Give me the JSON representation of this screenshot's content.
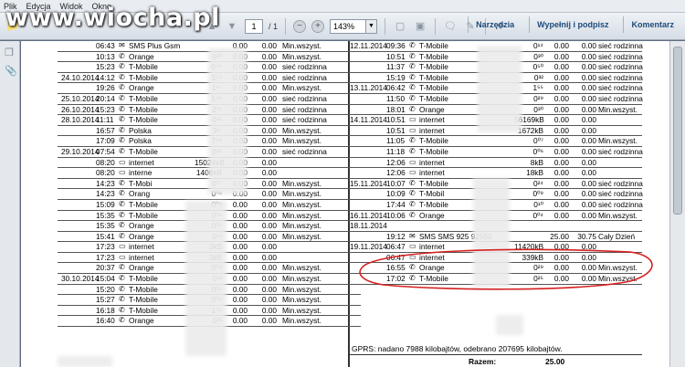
{
  "menu": {
    "items": [
      "Plik",
      "Edycja",
      "Widok",
      "Okno"
    ]
  },
  "watermark": "www.wiocha.pl",
  "toolbar": {
    "page_current": "1",
    "page_total": "/ 1",
    "zoom": "143%",
    "tools_label": "Narzędzia",
    "fill_sign_label": "Wypełnij i podpisz",
    "comments_label": "Komentarz"
  },
  "left_rows": [
    {
      "date": "",
      "time": "06:43",
      "icon": "sms-icon",
      "name": "SMS Plus Gsm",
      "dur": "",
      "price": "0.00",
      "cost": "0.00",
      "tariff": "Min.wszyst."
    },
    {
      "date": "",
      "time": "10:13",
      "icon": "phone-icon",
      "name": "Orange",
      "dur": "0²⁰",
      "price": "0.00",
      "cost": "0.00",
      "tariff": "Min.wszyst."
    },
    {
      "date": "",
      "time": "15:23",
      "icon": "phone-icon",
      "name": "T-Mobile",
      "dur": "0⁴⁶",
      "price": "0.00",
      "cost": "0.00",
      "tariff": "sieć rodzinna"
    },
    {
      "date": "24.10.2014",
      "time": "14:12",
      "icon": "phone-icon",
      "name": "T-Mobile",
      "dur": "1⁵⁸",
      "price": "0.00",
      "cost": "0.00",
      "tariff": "sieć rodzinna"
    },
    {
      "date": "",
      "time": "19:26",
      "icon": "phone-icon",
      "name": "Orange",
      "dur": "1⁹⁷",
      "price": "0.00",
      "cost": "0.00",
      "tariff": "Min.wszyst."
    },
    {
      "date": "25.10.2014",
      "time": "20:14",
      "icon": "phone-icon",
      "name": "T-Mobile",
      "dur": "1⁴⁹",
      "price": "0.00",
      "cost": "0.00",
      "tariff": "sieć rodzinna"
    },
    {
      "date": "26.10.2014",
      "time": "15:23",
      "icon": "phone-icon",
      "name": "T-Mobile",
      "dur": "2⁰¹",
      "price": "0.00",
      "cost": "0.00",
      "tariff": "sieć rodzinna"
    },
    {
      "date": "28.10.2014",
      "time": "11:11",
      "icon": "phone-icon",
      "name": "T-Mobile",
      "dur": "0³⁵",
      "price": "0.00",
      "cost": "0.00",
      "tariff": "sieć rodzinna"
    },
    {
      "date": "",
      "time": "16:57",
      "icon": "phone-icon",
      "name": "Polska",
      "dur": "3²⁷",
      "price": "0.00",
      "cost": "0.00",
      "tariff": "Min.wszyst."
    },
    {
      "date": "",
      "time": "17:09",
      "icon": "phone-icon",
      "name": "Polska",
      "dur": "7⁵⁸",
      "price": "0.00",
      "cost": "0.00",
      "tariff": "Min.wszyst."
    },
    {
      "date": "29.10.2014",
      "time": "07:54",
      "icon": "phone-icon",
      "name": "T-Mobile",
      "dur": "0²⁸",
      "price": "0.00",
      "cost": "0.00",
      "tariff": "sieć rodzinna"
    },
    {
      "date": "",
      "time": "08:20",
      "icon": "internet-icon",
      "name": "internet",
      "dur": "15024kB",
      "price": "0.00",
      "cost": "0.00",
      "tariff": ""
    },
    {
      "date": "",
      "time": "08:20",
      "icon": "internet-icon",
      "name": "interne",
      "dur": "1406kB",
      "price": "0.00",
      "cost": "0.00",
      "tariff": ""
    },
    {
      "date": "",
      "time": "14:23",
      "icon": "phone-icon",
      "name": "T-Mobi",
      "dur": "0⁰⁷",
      "price": "0.00",
      "cost": "0.00",
      "tariff": "Min.wszyst."
    },
    {
      "date": "",
      "time": "14:23",
      "icon": "phone-icon",
      "name": "Orang",
      "dur": "0⁰⁶",
      "price": "0.00",
      "cost": "0.00",
      "tariff": "Min.wszyst."
    },
    {
      "date": "",
      "time": "15:09",
      "icon": "phone-icon",
      "name": "T-Mobile",
      "dur": "0⁰⁹",
      "price": "0.00",
      "cost": "0.00",
      "tariff": "Min.wszyst."
    },
    {
      "date": "",
      "time": "15:35",
      "icon": "phone-icon",
      "name": "T-Mobile",
      "dur": "0⁰⁴",
      "price": "0.00",
      "cost": "0.00",
      "tariff": "Min.wszyst."
    },
    {
      "date": "",
      "time": "15:35",
      "icon": "phone-icon",
      "name": "Orange",
      "dur": "0⁰⁵",
      "price": "0.00",
      "cost": "0.00",
      "tariff": "Min.wszyst."
    },
    {
      "date": "",
      "time": "15:41",
      "icon": "phone-icon",
      "name": "Orange",
      "dur": "0¹⁹",
      "price": "0.00",
      "cost": "0.00",
      "tariff": "Min.wszyst."
    },
    {
      "date": "",
      "time": "17:23",
      "icon": "internet-icon",
      "name": "internet",
      "dur": "3kB",
      "price": "0.00",
      "cost": "0.00",
      "tariff": ""
    },
    {
      "date": "",
      "time": "17:23",
      "icon": "internet-icon",
      "name": "internet",
      "dur": "3kB",
      "price": "0.00",
      "cost": "0.00",
      "tariff": ""
    },
    {
      "date": "",
      "time": "20:37",
      "icon": "phone-icon",
      "name": "Orange",
      "dur": "0⁰⁹",
      "price": "0.00",
      "cost": "0.00",
      "tariff": "Min.wszyst."
    },
    {
      "date": "30.10.2014",
      "time": "15:04",
      "icon": "phone-icon",
      "name": "T-Mobile",
      "dur": "0¹²",
      "price": "0.00",
      "cost": "0.00",
      "tariff": "Min.wszyst."
    },
    {
      "date": "",
      "time": "15:20",
      "icon": "phone-icon",
      "name": "T-Mobile",
      "dur": "0⁰⁵",
      "price": "0.00",
      "cost": "0.00",
      "tariff": "Min.wszyst."
    },
    {
      "date": "",
      "time": "15:27",
      "icon": "phone-icon",
      "name": "T-Mobile",
      "dur": "0⁰⁸",
      "price": "0.00",
      "cost": "0.00",
      "tariff": "Min.wszyst."
    },
    {
      "date": "",
      "time": "16:18",
      "icon": "phone-icon",
      "name": "T-Mobile",
      "dur": "1⁰⁵",
      "price": "0.00",
      "cost": "0.00",
      "tariff": "Min.wszyst."
    },
    {
      "date": "",
      "time": "16:40",
      "icon": "phone-icon",
      "name": "Orange",
      "dur": "0²³",
      "price": "0.00",
      "cost": "0.00",
      "tariff": "Min.wszyst."
    }
  ],
  "right_rows": [
    {
      "date": "12.11.2014",
      "time": "09:36",
      "icon": "phone-icon",
      "name": "T-Mobile",
      "dur": "0¹⁴",
      "price": "0.00",
      "cost": "0.00",
      "tariff": "sieć rodzinna"
    },
    {
      "date": "",
      "time": "10:51",
      "icon": "phone-icon",
      "name": "T-Mobile",
      "dur": "0³⁰",
      "price": "0.00",
      "cost": "0.00",
      "tariff": "sieć rodzinna"
    },
    {
      "date": "",
      "time": "11:37",
      "icon": "phone-icon",
      "name": "T-Mobile",
      "dur": "0⁵⁰",
      "price": "0.00",
      "cost": "0.00",
      "tariff": "sieć rodzinna"
    },
    {
      "date": "",
      "time": "15:19",
      "icon": "phone-icon",
      "name": "T-Mobile",
      "dur": "0³²",
      "price": "0.00",
      "cost": "0.00",
      "tariff": "sieć rodzinna"
    },
    {
      "date": "13.11.2014",
      "time": "06:42",
      "icon": "phone-icon",
      "name": "T-Mobile",
      "dur": "1⁵⁵",
      "price": "0.00",
      "cost": "0.00",
      "tariff": "sieć rodzinna"
    },
    {
      "date": "",
      "time": "11:50",
      "icon": "phone-icon",
      "name": "T-Mobile",
      "dur": "0²⁹",
      "price": "0.00",
      "cost": "0.00",
      "tariff": "sieć rodzinna"
    },
    {
      "date": "",
      "time": "18:01",
      "icon": "phone-icon",
      "name": "Orange",
      "dur": "0³⁰",
      "price": "0.00",
      "cost": "0.00",
      "tariff": "Min.wszyst."
    },
    {
      "date": "14.11.2014",
      "time": "10:51",
      "icon": "internet-icon",
      "name": "internet",
      "dur": "56169kB",
      "price": "0.00",
      "cost": "0.00",
      "tariff": ""
    },
    {
      "date": "",
      "time": "10:51",
      "icon": "internet-icon",
      "name": "internet",
      "dur": "1672kB",
      "price": "0.00",
      "cost": "0.00",
      "tariff": ""
    },
    {
      "date": "",
      "time": "11:05",
      "icon": "phone-icon",
      "name": "T-Mobile",
      "dur": "0⁰⁷",
      "price": "0.00",
      "cost": "0.00",
      "tariff": "Min.wszyst."
    },
    {
      "date": "",
      "time": "11:18",
      "icon": "phone-icon",
      "name": "T-Mobile",
      "dur": "0⁰⁶",
      "price": "0.00",
      "cost": "0.00",
      "tariff": "sieć rodzinna"
    },
    {
      "date": "",
      "time": "12:06",
      "icon": "internet-icon",
      "name": "internet",
      "dur": "8kB",
      "price": "0.00",
      "cost": "0.00",
      "tariff": ""
    },
    {
      "date": "",
      "time": "12:06",
      "icon": "internet-icon",
      "name": "internet",
      "dur": "18kB",
      "price": "0.00",
      "cost": "0.00",
      "tariff": ""
    },
    {
      "date": "15.11.2014",
      "time": "10:07",
      "icon": "phone-icon",
      "name": "T-Mobile",
      "dur": "0²⁴",
      "price": "0.00",
      "cost": "0.00",
      "tariff": "sieć rodzinna"
    },
    {
      "date": "",
      "time": "10:09",
      "icon": "phone-icon",
      "name": "T-Mobil",
      "dur": "0⁰⁹",
      "price": "0.00",
      "cost": "0.00",
      "tariff": "sieć rodzinna"
    },
    {
      "date": "",
      "time": "17:44",
      "icon": "phone-icon",
      "name": "T-Mobile",
      "dur": "0¹⁰",
      "price": "0.00",
      "cost": "0.00",
      "tariff": "sieć rodzinna"
    },
    {
      "date": "16.11.2014",
      "time": "10:06",
      "icon": "phone-icon",
      "name": "Orange",
      "dur": "0⁰⁴",
      "price": "0.00",
      "cost": "0.00",
      "tariff": "Min.wszyst."
    },
    {
      "date": "18.11.2014",
      "time": "",
      "icon": "",
      "name": "",
      "dur": "",
      "price": "",
      "cost": "",
      "tariff": ""
    },
    {
      "date": "",
      "time": "19:12",
      "icon": "sms-icon",
      "name": "SMS SMS 925   92550",
      "dur": "",
      "price": "25.00",
      "cost": "30.75",
      "tariff": "Cały Dzień"
    },
    {
      "date": "19.11.2014",
      "time": "06:47",
      "icon": "internet-icon",
      "name": "internet",
      "dur": "11420kB",
      "price": "0.00",
      "cost": "0.00",
      "tariff": ""
    },
    {
      "date": "",
      "time": "06:47",
      "icon": "internet-icon",
      "name": "internet",
      "dur": "339kB",
      "price": "0.00",
      "cost": "0.00",
      "tariff": ""
    },
    {
      "date": "",
      "time": "16:55",
      "icon": "phone-icon",
      "name": "Orange",
      "dur": "0²⁹",
      "price": "0.00",
      "cost": "0.00",
      "tariff": "Min.wszyst."
    },
    {
      "date": "",
      "time": "17:02",
      "icon": "phone-icon",
      "name": "T-Mobile",
      "dur": "0²⁵",
      "price": "0.00",
      "cost": "0.00",
      "tariff": "Min.wszyst."
    }
  ],
  "summary": {
    "gprs": "GPRS: nadano 7988 kilobajtów, odebrano 207695 kilobajtów.",
    "total_label": "Razem:",
    "total_value": "25.00"
  },
  "colors": {
    "annotation": "#d62020",
    "toolbar_bg": "#dfe5eb",
    "accent_text": "#1d4a7a"
  }
}
